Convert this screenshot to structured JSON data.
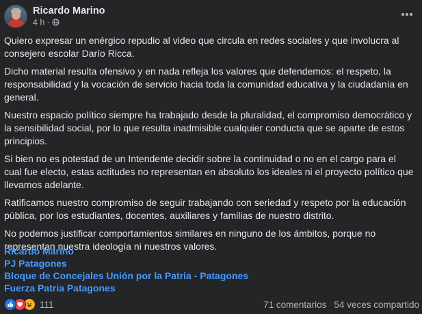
{
  "post": {
    "author": "Ricardo Marino",
    "time": "4 h",
    "separator": "·",
    "paragraphs": [
      "Quiero expresar un enérgico repudio al video que circula en redes sociales y que involucra al consejero escolar  Darío Ricca.",
      "Dicho material resulta ofensivo y en nada refleja los valores que defendemos: el respeto, la responsabilidad y la vocación de servicio hacia toda la comunidad educativa y la ciudadanía en general.",
      "Nuestro espacio político siempre ha trabajado desde la pluralidad, el compromiso democrático y la sensibilidad social, por lo que resulta inadmisible cualquier conducta que se aparte de estos principios.",
      "Si bien no es potestad de un Intendente decidir sobre la continuidad o no en el cargo para el cual fue electo, estas actitudes no representan en absoluto los ideales ni el proyecto político que llevamos adelante.",
      "Ratificamos nuestro compromiso de seguir trabajando con seriedad y respeto por la educación pública, por los estudiantes, docentes, auxiliares y familias de nuestro distrito.",
      "No podemos justificar comportamientos similares en ninguno de los ámbitos, porque no representan nuestra ideología ni nuestros valores."
    ],
    "tags": [
      "Ricardo Marino",
      "PJ Patagones",
      "Bloque de Concejales Unión por la Patria - Patagones",
      "Fuerza Patria Patagones"
    ]
  },
  "footer": {
    "reaction_count": "111",
    "comments": "71 comentarios",
    "shares": "54 veces compartido",
    "reactions": [
      "like",
      "love",
      "haha"
    ]
  },
  "colors": {
    "background": "#242526",
    "text": "#e4e6eb",
    "secondary": "#b0b3b8",
    "link": "#4599ff",
    "like": "#1877f2",
    "love": "#f33e58",
    "haha": "#f7b125"
  }
}
